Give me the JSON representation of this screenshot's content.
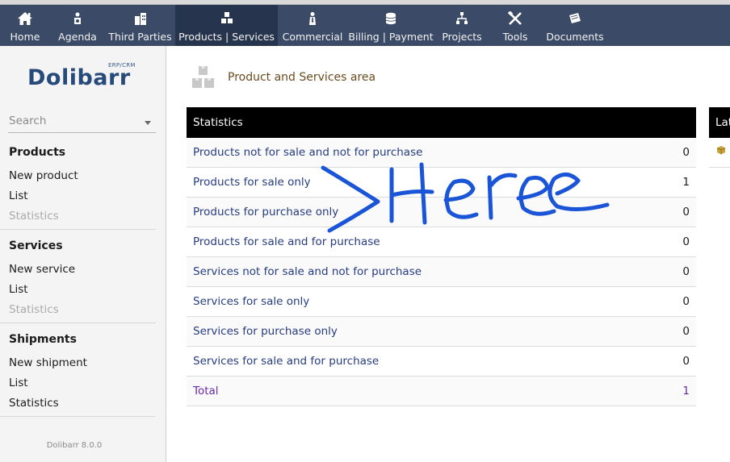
{
  "nav": {
    "items": [
      {
        "label": "Home",
        "icon": "home-icon"
      },
      {
        "label": "Agenda",
        "icon": "agenda-icon"
      },
      {
        "label": "Third Parties",
        "icon": "building-icon"
      },
      {
        "label": "Products | Services",
        "icon": "boxes-icon",
        "active": true
      },
      {
        "label": "Commercial",
        "icon": "commercial-icon"
      },
      {
        "label": "Billing | Payment",
        "icon": "coins-icon"
      },
      {
        "label": "Projects",
        "icon": "projects-icon"
      },
      {
        "label": "Tools",
        "icon": "tools-icon"
      },
      {
        "label": "Documents",
        "icon": "documents-icon"
      }
    ]
  },
  "sidebar": {
    "logo": {
      "name": "Dolibarr",
      "tag": "ERP/CRM"
    },
    "search": {
      "placeholder": "Search"
    },
    "products": {
      "title": "Products",
      "links": [
        "New product",
        "List",
        "Statistics"
      ]
    },
    "services": {
      "title": "Services",
      "links": [
        "New service",
        "List",
        "Statistics"
      ]
    },
    "shipments": {
      "title": "Shipments",
      "links": [
        "New shipment",
        "List",
        "Statistics"
      ]
    },
    "version": "Dolibarr 8.0.0"
  },
  "main": {
    "title": "Product and Services area",
    "stats": {
      "header": "Statistics",
      "rows": [
        {
          "label": "Products not for sale and not for purchase",
          "value": "0"
        },
        {
          "label": "Products for sale only",
          "value": "1"
        },
        {
          "label": "Products for purchase only",
          "value": "0"
        },
        {
          "label": "Products for sale and for purchase",
          "value": "0"
        },
        {
          "label": "Services not for sale and not for purchase",
          "value": "0"
        },
        {
          "label": "Services for sale only",
          "value": "0"
        },
        {
          "label": "Services for purchase only",
          "value": "0"
        },
        {
          "label": "Services for sale and for purchase",
          "value": "0"
        }
      ],
      "total": {
        "label": "Total",
        "value": "1"
      }
    },
    "latest": {
      "header": "Latest"
    }
  },
  "colors": {
    "topbar": "#3b4a66",
    "topbar_active": "#27344d",
    "table_header": "#000000",
    "link": "#263c82",
    "title": "#6b4b1e",
    "annotation": "#1a55d8"
  }
}
